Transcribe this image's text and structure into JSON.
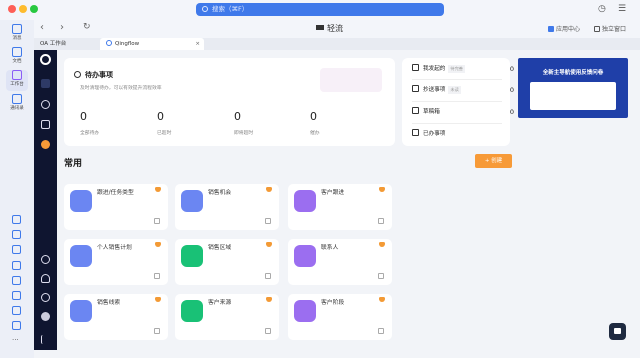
{
  "titlebar": {
    "search_placeholder": "搜索（⌘F）"
  },
  "nav": {
    "app_title": "轻流",
    "app_center": "应用中心",
    "standalone": "独立窗口"
  },
  "left_nav": [
    {
      "label": "消息"
    },
    {
      "label": "文档"
    },
    {
      "label": "工作台"
    },
    {
      "label": "通讯录"
    }
  ],
  "tabs": [
    {
      "label": "OA 工作台"
    },
    {
      "label": "Qingflow",
      "close": "×"
    }
  ],
  "todo": {
    "title": "待办事项",
    "subtitle": "及时清理待办，可以有效提升流程效率",
    "stats": [
      {
        "value": "0",
        "label": "全部待办"
      },
      {
        "value": "0",
        "label": "已超时"
      },
      {
        "value": "0",
        "label": "即将超时"
      },
      {
        "value": "0",
        "label": "催办"
      }
    ]
  },
  "right_panel": [
    {
      "label": "我发起的",
      "badge": "待完善",
      "count": "0"
    },
    {
      "label": "抄送事项",
      "badge": "未读",
      "count": "0"
    },
    {
      "label": "草稿箱",
      "count": "0"
    },
    {
      "label": "已办事项"
    }
  ],
  "banner": {
    "title": "全新主导航使用反馈问卷"
  },
  "section": {
    "title": "常用",
    "create": "+ 创建"
  },
  "tiles": [
    {
      "label": "跟进/任务类型",
      "color": "#6b86f2"
    },
    {
      "label": "销售机会",
      "color": "#6b86f2"
    },
    {
      "label": "客户跟进",
      "color": "#9b6ef0"
    },
    {
      "label": "个人销售计划",
      "color": "#6b86f2"
    },
    {
      "label": "销售区域",
      "color": "#19c176"
    },
    {
      "label": "联系人",
      "color": "#9b6ef0"
    },
    {
      "label": "销售线索",
      "color": "#6b86f2"
    },
    {
      "label": "客户来源",
      "color": "#19c176"
    },
    {
      "label": "客户阶段",
      "color": "#9b6ef0"
    }
  ],
  "colors": {
    "accent": "#3f79ea",
    "create_button": "#f79a38",
    "sidebar_dark": "#0f1530"
  }
}
